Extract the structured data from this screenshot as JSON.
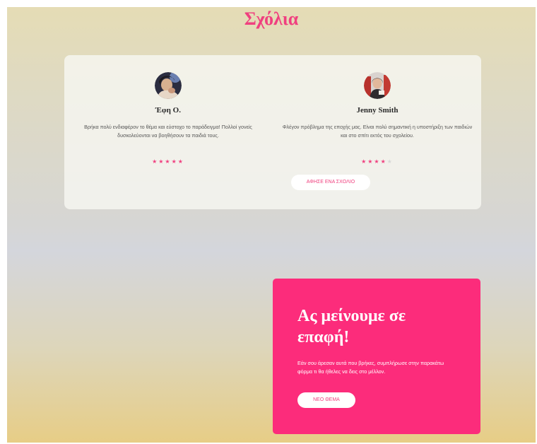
{
  "reviews": {
    "title": "Σχόλια",
    "items": [
      {
        "name": "Έφη Ο.",
        "text": "Βρήκα πολύ ενδιαφέρον το θέμα και εύστοχο το παράδειγμα! Πολλοί γονείς δυσκολεύονται να βοηθήσουν τα παιδιά τους.",
        "rating": 5,
        "max_rating": 5
      },
      {
        "name": "Jenny Smith",
        "text": "Φλέγον πρόβλημα της εποχής μας. Είναι πολύ σημαντική η υποστήριξη των παιδιών και στο σπίτι εκτός του σχολείου.",
        "rating": 4,
        "max_rating": 5
      }
    ],
    "leave_review_label": "ΑΦΗΣΕ ΕΝΑ ΣΧΟΛΙΟ"
  },
  "contact": {
    "title": "Ας μείνουμε σε επαφή!",
    "text": "Εάν σου άρεσαν αυτά που βρήκες, συμπλήρωσε στην παρακάτω φόρμα τι θα ήθελες να δεις στο μέλλον.",
    "new_topic_label": "ΝΕΟ ΘΕΜΑ"
  },
  "colors": {
    "accent": "#f0407f",
    "contact_bg": "#fc2c7b",
    "star_empty": "#d8d8d8"
  }
}
